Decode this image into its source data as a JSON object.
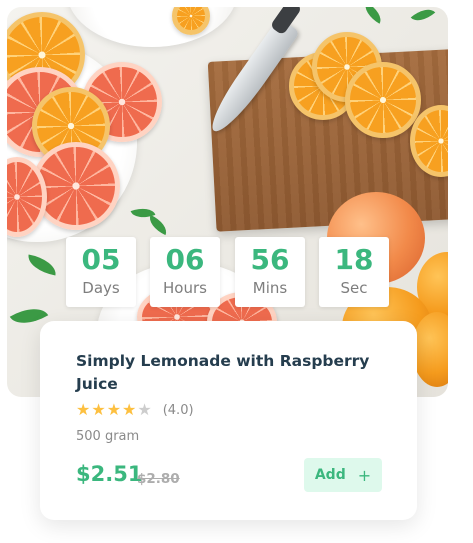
{
  "countdown": {
    "days": {
      "value": "05",
      "label": "Days"
    },
    "hours": {
      "value": "06",
      "label": "Hours"
    },
    "mins": {
      "value": "56",
      "label": "Mins"
    },
    "secs": {
      "value": "18",
      "label": "Sec"
    }
  },
  "product": {
    "title": "Simply Lemonade with Raspberry Juice",
    "rating_text": "(4.0)",
    "rating_value": 4,
    "rating_max": 5,
    "weight": "500 gram",
    "price": "$2.51",
    "old_price": "$2.80",
    "add_label": "Add",
    "add_icon": "plus-icon"
  },
  "colors": {
    "accent": "#3bb77e",
    "accent_light": "#def9ec",
    "star": "#fdc040",
    "heading": "#253d4e",
    "muted": "#8a8a8a"
  }
}
